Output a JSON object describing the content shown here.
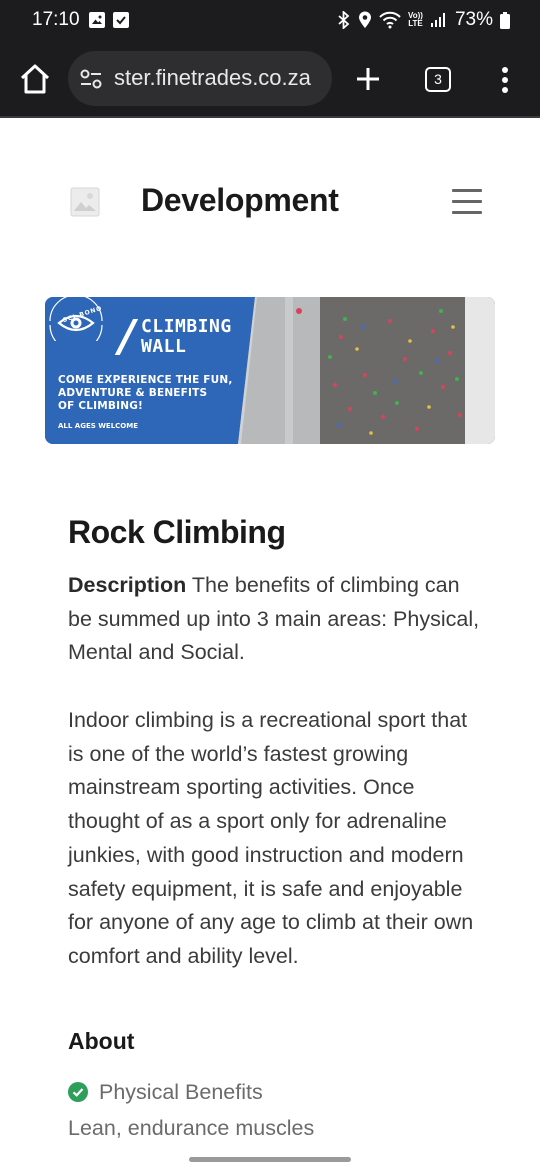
{
  "status_bar": {
    "time": "17:10",
    "battery": "73%",
    "lte_top": "Vo))",
    "lte_bottom": "LTE"
  },
  "browser": {
    "url": "ster.finetrades.co.za",
    "tab_count": "3"
  },
  "site": {
    "title": "Development"
  },
  "banner": {
    "brand": "SCI-BONO",
    "title_line1": "CLIMBING",
    "title_line2": "WALL",
    "tagline_line1": "COME EXPERIENCE THE FUN,",
    "tagline_line2": "ADVENTURE & BENEFITS",
    "tagline_line3": "OF CLIMBING!",
    "ages": "ALL AGES WELCOME"
  },
  "content": {
    "heading": "Rock Climbing",
    "description_label": "Description",
    "description_text": " The benefits of climbing can be summed up into 3 main areas: Physical, Mental and Social.",
    "paragraph": "Indoor climbing is a recreational sport that is one of the world’s fastest growing mainstream sporting activities. Once thought of as a sport only for adrenaline junkies, with good instruction and modern safety equipment, it is safe and enjoyable for anyone of any age to climb at their own comfort and ability level.",
    "about_heading": "About",
    "features": [
      {
        "label": "Physical Benefits",
        "detail": "Lean, endurance muscles"
      }
    ]
  },
  "colors": {
    "chrome": "#1c1c1e",
    "urlbar": "#2e2e31",
    "banner_blue": "#2e67b8",
    "check_green": "#2e9e5b"
  },
  "icons": [
    "image-icon",
    "photo-icon",
    "bluetooth-icon",
    "location-icon",
    "wifi-icon",
    "signal-icon",
    "battery-icon",
    "home-icon",
    "site-settings-icon",
    "plus-icon",
    "tabs-icon",
    "more-vert-icon",
    "image-placeholder-icon",
    "hamburger-menu-icon",
    "eye-logo-icon",
    "check-circle-icon"
  ]
}
